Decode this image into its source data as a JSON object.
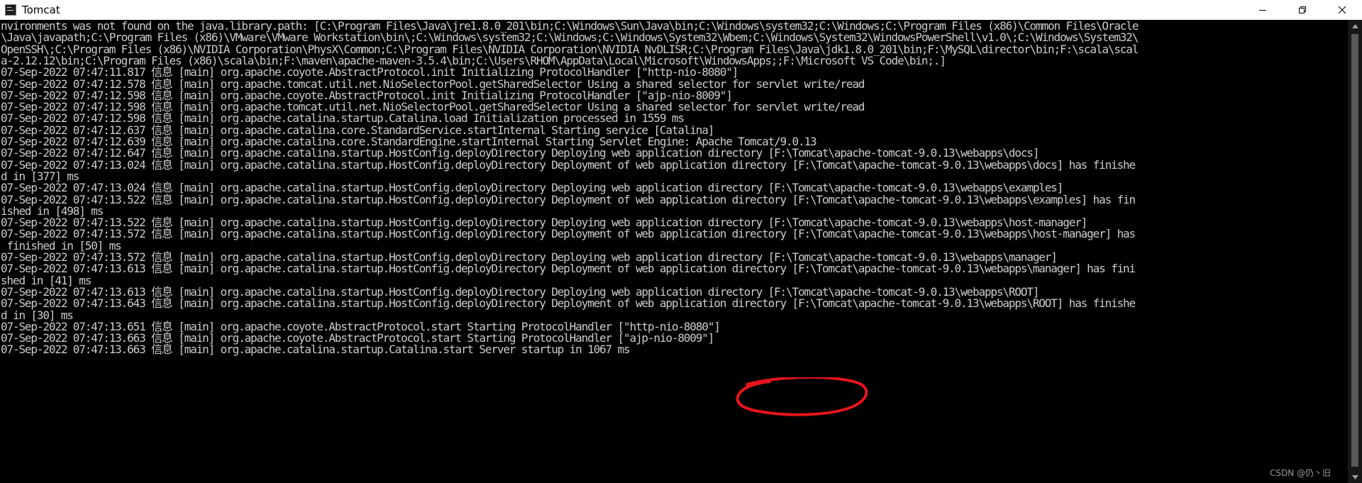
{
  "window": {
    "title": "Tomcat"
  },
  "icons": {
    "app": "console-app-icon",
    "minimize": "minimize-icon",
    "maximize": "maximize-icon",
    "close": "close-icon",
    "scroll_up": "scroll-up-arrow-icon",
    "scroll_down": "scroll-down-arrow-icon"
  },
  "console": {
    "lines": [
      "nvironments was not found on the java.library.path: [C:\\Program Files\\Java\\jre1.8.0_201\\bin;C:\\Windows\\Sun\\Java\\bin;C:\\Windows\\system32;C:\\Windows;C:\\Program Files (x86)\\Common Files\\Oracle",
      "\\Java\\javapath;C:\\Program Files (x86)\\VMware\\VMware Workstation\\bin\\;C:\\Windows\\system32;C:\\Windows;C:\\Windows\\System32\\Wbem;C:\\Windows\\System32\\WindowsPowerShell\\v1.0\\;C:\\Windows\\System32\\",
      "OpenSSH\\;C:\\Program Files (x86)\\NVIDIA Corporation\\PhysX\\Common;C:\\Program Files\\NVIDIA Corporation\\NVIDIA NvDLISR;C:\\Program Files\\Java\\jdk1.8.0_201\\bin;F:\\MySQL\\director\\bin;F:\\scala\\scal",
      "a-2.12.12\\bin;C:\\Program Files (x86)\\scala\\bin;F:\\maven\\apache-maven-3.5.4\\bin;C:\\Users\\RHOM\\AppData\\Local\\Microsoft\\WindowsApps;;F:\\Microsoft VS Code\\bin;.]",
      "07-Sep-2022 07:47:11.817 信息 [main] org.apache.coyote.AbstractProtocol.init Initializing ProtocolHandler [\"http-nio-8080\"]",
      "07-Sep-2022 07:47:12.578 信息 [main] org.apache.tomcat.util.net.NioSelectorPool.getSharedSelector Using a shared selector for servlet write/read",
      "07-Sep-2022 07:47:12.598 信息 [main] org.apache.coyote.AbstractProtocol.init Initializing ProtocolHandler [\"ajp-nio-8009\"]",
      "07-Sep-2022 07:47:12.598 信息 [main] org.apache.tomcat.util.net.NioSelectorPool.getSharedSelector Using a shared selector for servlet write/read",
      "07-Sep-2022 07:47:12.598 信息 [main] org.apache.catalina.startup.Catalina.load Initialization processed in 1559 ms",
      "07-Sep-2022 07:47:12.637 信息 [main] org.apache.catalina.core.StandardService.startInternal Starting service [Catalina]",
      "07-Sep-2022 07:47:12.639 信息 [main] org.apache.catalina.core.StandardEngine.startInternal Starting Servlet Engine: Apache Tomcat/9.0.13",
      "07-Sep-2022 07:47:12.647 信息 [main] org.apache.catalina.startup.HostConfig.deployDirectory Deploying web application directory [F:\\Tomcat\\apache-tomcat-9.0.13\\webapps\\docs]",
      "07-Sep-2022 07:47:13.024 信息 [main] org.apache.catalina.startup.HostConfig.deployDirectory Deployment of web application directory [F:\\Tomcat\\apache-tomcat-9.0.13\\webapps\\docs] has finishe",
      "d in [377] ms",
      "07-Sep-2022 07:47:13.024 信息 [main] org.apache.catalina.startup.HostConfig.deployDirectory Deploying web application directory [F:\\Tomcat\\apache-tomcat-9.0.13\\webapps\\examples]",
      "07-Sep-2022 07:47:13.522 信息 [main] org.apache.catalina.startup.HostConfig.deployDirectory Deployment of web application directory [F:\\Tomcat\\apache-tomcat-9.0.13\\webapps\\examples] has fin",
      "ished in [498] ms",
      "07-Sep-2022 07:47:13.522 信息 [main] org.apache.catalina.startup.HostConfig.deployDirectory Deploying web application directory [F:\\Tomcat\\apache-tomcat-9.0.13\\webapps\\host-manager]",
      "07-Sep-2022 07:47:13.572 信息 [main] org.apache.catalina.startup.HostConfig.deployDirectory Deployment of web application directory [F:\\Tomcat\\apache-tomcat-9.0.13\\webapps\\host-manager] has",
      " finished in [50] ms",
      "07-Sep-2022 07:47:13.572 信息 [main] org.apache.catalina.startup.HostConfig.deployDirectory Deploying web application directory [F:\\Tomcat\\apache-tomcat-9.0.13\\webapps\\manager]",
      "07-Sep-2022 07:47:13.613 信息 [main] org.apache.catalina.startup.HostConfig.deployDirectory Deployment of web application directory [F:\\Tomcat\\apache-tomcat-9.0.13\\webapps\\manager] has fini",
      "shed in [41] ms",
      "07-Sep-2022 07:47:13.613 信息 [main] org.apache.catalina.startup.HostConfig.deployDirectory Deploying web application directory [F:\\Tomcat\\apache-tomcat-9.0.13\\webapps\\ROOT]",
      "07-Sep-2022 07:47:13.643 信息 [main] org.apache.catalina.startup.HostConfig.deployDirectory Deployment of web application directory [F:\\Tomcat\\apache-tomcat-9.0.13\\webapps\\ROOT] has finishe",
      "d in [30] ms",
      "07-Sep-2022 07:47:13.651 信息 [main] org.apache.coyote.AbstractProtocol.start Starting ProtocolHandler [\"http-nio-8080\"]",
      "07-Sep-2022 07:47:13.663 信息 [main] org.apache.coyote.AbstractProtocol.start Starting ProtocolHandler [\"ajp-nio-8009\"]",
      "07-Sep-2022 07:47:13.663 信息 [main] org.apache.catalina.startup.Catalina.start Server startup in 1067 ms"
    ]
  },
  "watermark": {
    "text": "CSDN @仍丶旧"
  },
  "colors": {
    "console_bg": "#000000",
    "console_text": "#cccccc",
    "annotation": "#e8141c",
    "titlebar_bg": "#ffffff"
  }
}
